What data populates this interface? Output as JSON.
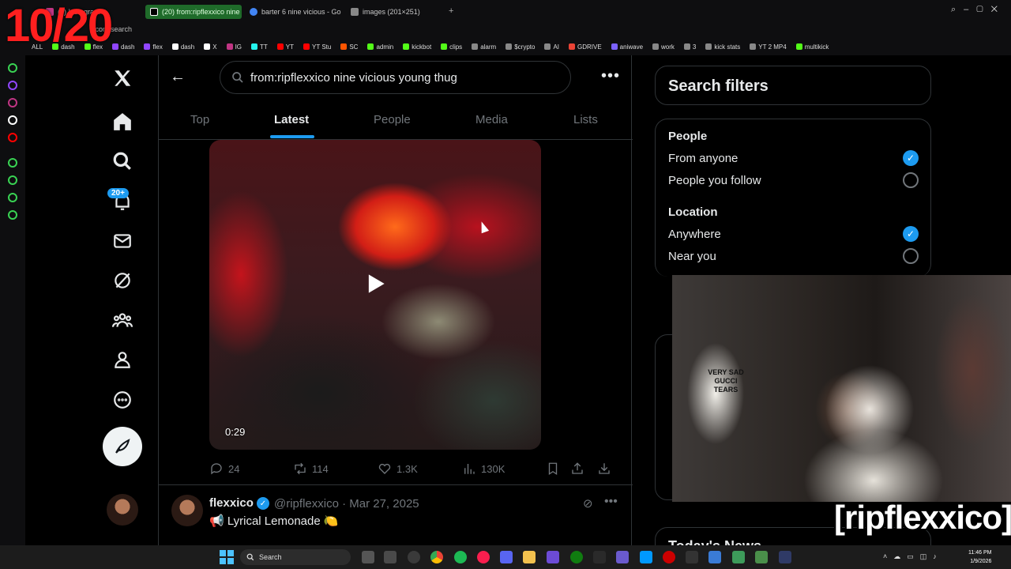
{
  "overlay": {
    "counter": "10/20",
    "handle": "[ripflexxico]",
    "shirt_text": "VERY SAD GUCCI TEARS"
  },
  "browser": {
    "tabs": [
      {
        "label": "(7) Instagram",
        "color": "#c13584"
      },
      {
        "label": "(20) from:ripflexxico nine",
        "color": "#000000",
        "active": true
      },
      {
        "label": "barter 6 nine vicious - Go",
        "color": "#4285f4"
      },
      {
        "label": "images (201×251)",
        "color": "#888888"
      }
    ],
    "address": ".com/search",
    "bookmarks": [
      "dash",
      "flex",
      "dash",
      "flex",
      "dash",
      "X",
      "IG",
      "TT",
      "YT",
      "YT Stu",
      "SC",
      "admin",
      "kickbot",
      "clips",
      "alarm",
      "$crypto",
      "AI",
      "GDRIVE",
      "aniwave",
      "work",
      "3",
      "kick stats",
      "YT 2 MP4",
      "multikick"
    ],
    "bookmark_first": "ALL"
  },
  "nav": {
    "notification_badge": "20+",
    "icons": [
      "x-logo-icon",
      "home-icon",
      "explore-icon",
      "notifications-icon",
      "messages-icon",
      "grok-icon",
      "communities-icon",
      "profile-icon",
      "more-icon"
    ]
  },
  "search": {
    "query": "from:ripflexxico nine vicious young thug"
  },
  "tabs": [
    "Top",
    "Latest",
    "People",
    "Media",
    "Lists"
  ],
  "active_tab": "Latest",
  "video": {
    "duration": "0:29"
  },
  "actions": {
    "replies": "24",
    "reposts": "114",
    "likes": "1.3K",
    "views": "130K"
  },
  "tweet": {
    "name": "flexxico",
    "meta": "@ripflexxico · Mar 27, 2025",
    "text": "📢 Lyrical Lemonade 🍋"
  },
  "filters": {
    "title": "Search filters",
    "people_heading": "People",
    "from_anyone": "From anyone",
    "people_you_follow": "People you follow",
    "location_heading": "Location",
    "anywhere": "Anywhere",
    "near_you": "Near you",
    "from_anyone_checked": true,
    "anywhere_checked": true
  },
  "news": {
    "title": "Today's News"
  },
  "taskbar": {
    "search_label": "Search",
    "time": "11:46 PM",
    "date": "1/9/2026"
  }
}
